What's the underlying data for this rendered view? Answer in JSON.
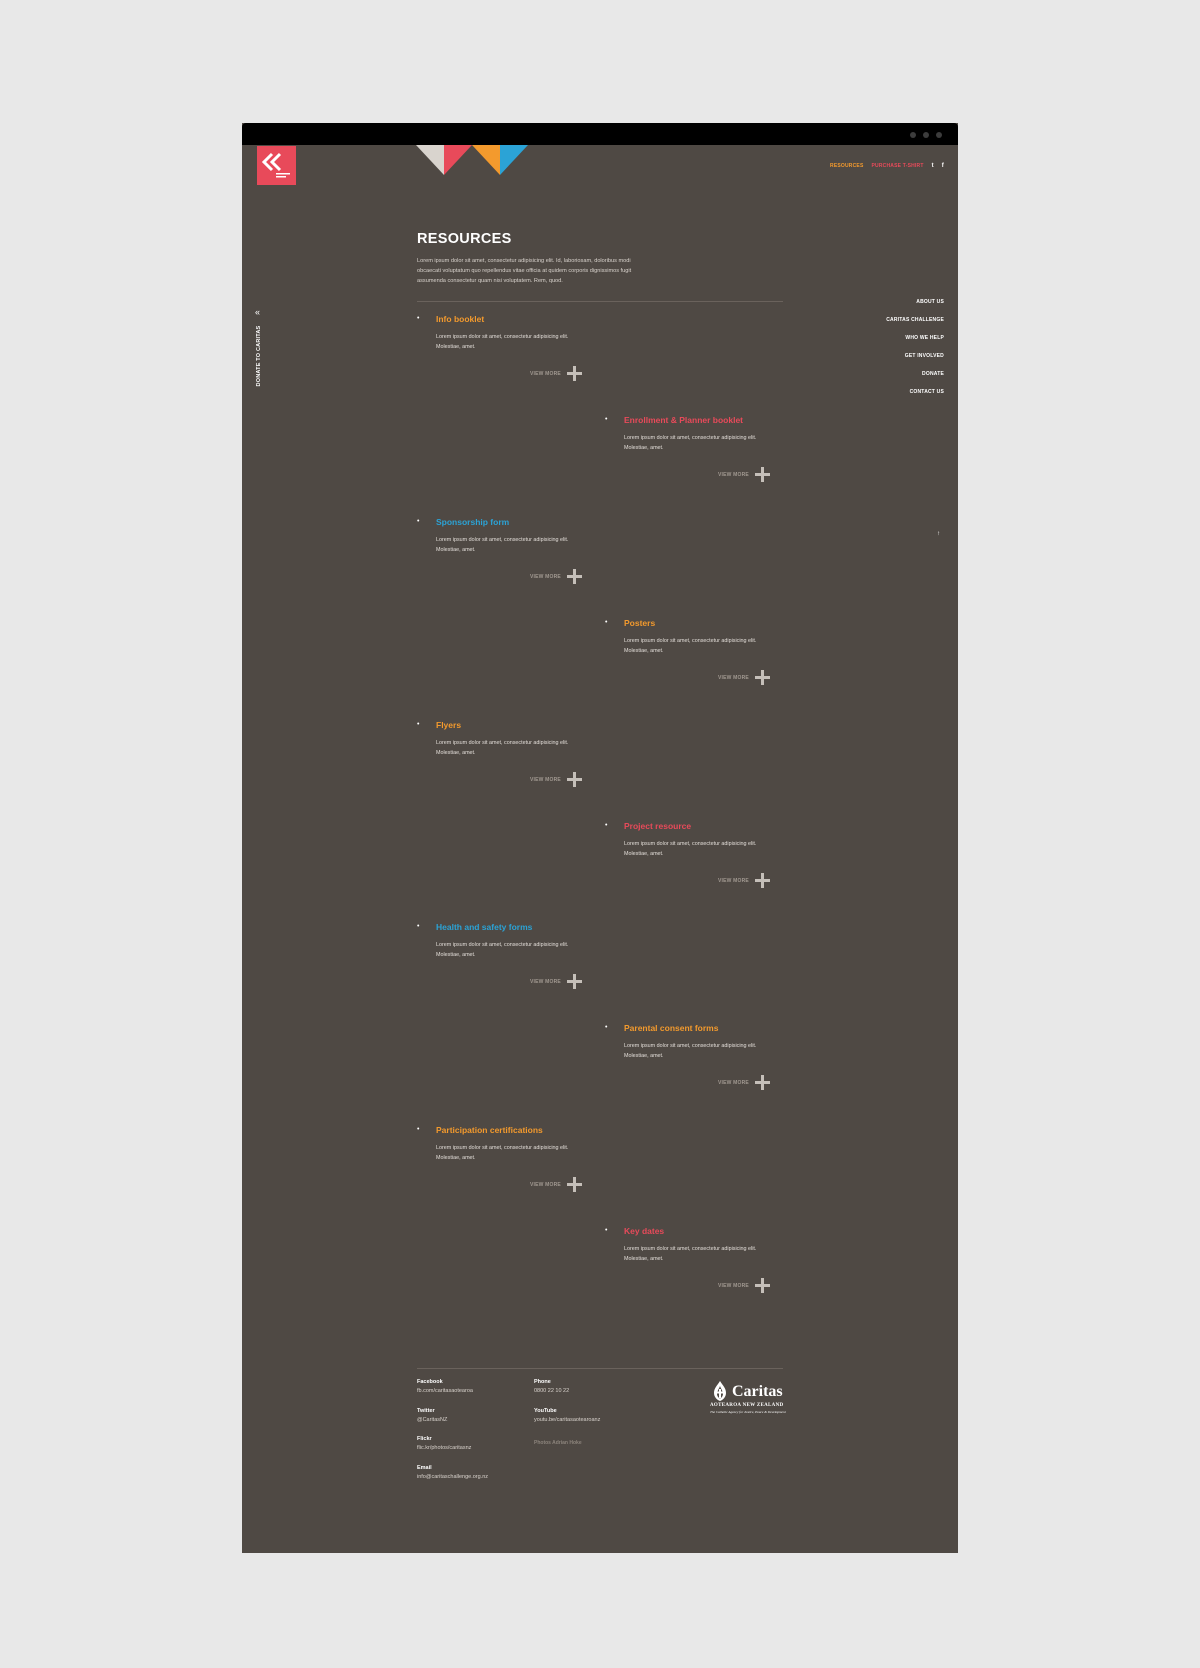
{
  "nav": {
    "resources": "RESOURCES",
    "purchase": "PURCHASE T-SHIRT",
    "twitter_glyph": "t",
    "facebook_glyph": "f"
  },
  "side_nav": [
    "ABOUT US",
    "CARITAS CHALLENGE",
    "WHO WE HELP",
    "GET INVOLVED",
    "DONATE",
    "CONTACT US"
  ],
  "donate_vertical": {
    "arrows": "«",
    "label": "DONATE TO CARITAS"
  },
  "back_top": "↑",
  "page": {
    "title": "RESOURCES",
    "description": "Lorem ipsum dolor sit amet, consectetur adipisicing elit. Id, laboriosam, doloribus modi obcaecati voluptatum quo repellendus vitae officia at quidem corporis dignissimos fugit assumenda consectetur quam nisi voluptatem. Rem, quod."
  },
  "resources": [
    {
      "title": "Info booklet",
      "color": "#f39a2d",
      "side": "left",
      "description": "Lorem ipsum dolor sit amet, consectetur adipisicing elit. Molestiae, amet.",
      "view_more": "VIEW MORE"
    },
    {
      "title": "Enrollment & Planner booklet",
      "color": "#e84a5a",
      "side": "right",
      "description": "Lorem ipsum dolor sit amet, consectetur adipisicing elit. Molestiae, amet.",
      "view_more": "VIEW MORE"
    },
    {
      "title": "Sponsorship form",
      "color": "#2ba3d6",
      "side": "left",
      "description": "Lorem ipsum dolor sit amet, consectetur adipisicing elit. Molestiae, amet.",
      "view_more": "VIEW MORE"
    },
    {
      "title": "Posters",
      "color": "#f39a2d",
      "side": "right",
      "description": "Lorem ipsum dolor sit amet, consectetur adipisicing elit. Molestiae, amet.",
      "view_more": "VIEW MORE"
    },
    {
      "title": "Flyers",
      "color": "#f39a2d",
      "side": "left",
      "description": "Lorem ipsum dolor sit amet, consectetur adipisicing elit. Molestiae, amet.",
      "view_more": "VIEW MORE"
    },
    {
      "title": "Project resource",
      "color": "#e84a5a",
      "side": "right",
      "description": "Lorem ipsum dolor sit amet, consectetur adipisicing elit. Molestiae, amet.",
      "view_more": "VIEW MORE"
    },
    {
      "title": "Health and safety forms",
      "color": "#2ba3d6",
      "side": "left",
      "description": "Lorem ipsum dolor sit amet, consectetur adipisicing elit. Molestiae, amet.",
      "view_more": "VIEW MORE"
    },
    {
      "title": "Parental consent forms",
      "color": "#f39a2d",
      "side": "right",
      "description": "Lorem ipsum dolor sit amet, consectetur adipisicing elit. Molestiae, amet.",
      "view_more": "VIEW MORE"
    },
    {
      "title": "Participation certifications",
      "color": "#f39a2d",
      "side": "left",
      "description": "Lorem ipsum dolor sit amet, consectetur adipisicing elit. Molestiae, amet.",
      "view_more": "VIEW MORE"
    },
    {
      "title": "Key dates",
      "color": "#e84a5a",
      "side": "right",
      "description": "Lorem ipsum dolor sit amet, consectetur adipisicing elit. Molestiae, amet.",
      "view_more": "VIEW MORE"
    }
  ],
  "footer": {
    "left": [
      {
        "label": "Facebook",
        "value": "fb.com/caritasaotearoa"
      },
      {
        "label": "Twitter",
        "value": "@CaritasNZ"
      },
      {
        "label": "Flickr",
        "value": "flic.kr/photos/caritasnz"
      },
      {
        "label": "Email",
        "value": "info@caritaschallenge.org.nz"
      }
    ],
    "middle": [
      {
        "label": "Phone",
        "value": "0800 22 10 22"
      },
      {
        "label": "YouTube",
        "value": "youtu.be/caritasaotearoanz"
      }
    ],
    "photos_credit": "Photos Adrian Hoke",
    "logo": {
      "name": "Caritas",
      "line1": "AOTEAROA NEW ZEALAND",
      "line2": "The Catholic Agency for Justice, Peace & Development"
    }
  },
  "colors": {
    "orange": "#f39a2d",
    "pink": "#e84a5a",
    "blue": "#2ba3d6",
    "background": "#4f4944"
  }
}
